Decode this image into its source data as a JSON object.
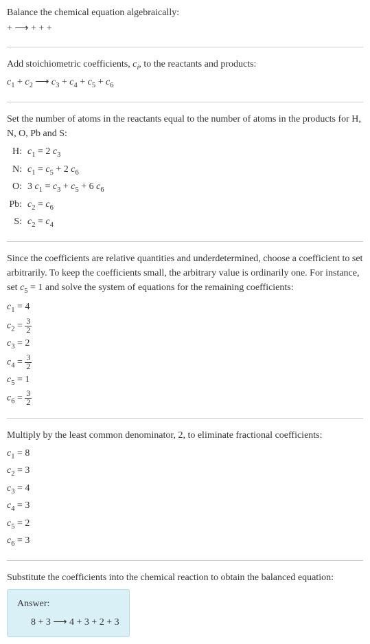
{
  "section1": {
    "title": "Balance the chemical equation algebraically:",
    "eq": " +  ⟶  +  +  + "
  },
  "section2": {
    "title_part1": "Add stoichiometric coefficients, ",
    "title_ci": "c",
    "title_i": "i",
    "title_part2": ", to the reactants and products:",
    "eq_c1": "c",
    "eq_1": "1",
    "eq_plus1": " + ",
    "eq_c2": "c",
    "eq_2": "2",
    "eq_arrow": " ⟶ ",
    "eq_c3": "c",
    "eq_3": "3",
    "eq_plus2": " + ",
    "eq_c4": "c",
    "eq_4": "4",
    "eq_plus3": " + ",
    "eq_c5": "c",
    "eq_5": "5",
    "eq_plus4": " + ",
    "eq_c6": "c",
    "eq_6": "6"
  },
  "section3": {
    "title": "Set the number of atoms in the reactants equal to the number of atoms in the products for H, N, O, Pb and S:",
    "atoms": [
      {
        "label": "H:",
        "lhs_c": "c",
        "lhs_s": "1",
        "eq": " = 2 ",
        "rhs_c": "c",
        "rhs_s": "3",
        "extra": ""
      },
      {
        "label": "N:",
        "lhs_c": "c",
        "lhs_s": "1",
        "eq": " = ",
        "rhs_c": "c",
        "rhs_s": "5",
        "extra": " + 2 ",
        "ex_c": "c",
        "ex_s": "6"
      },
      {
        "label": "O:",
        "pre": "3 ",
        "lhs_c": "c",
        "lhs_s": "1",
        "eq": " = ",
        "rhs_c": "c",
        "rhs_s": "3",
        "extra": " + ",
        "ex_c": "c",
        "ex_s": "5",
        "extra2": " + 6 ",
        "ex2_c": "c",
        "ex2_s": "6"
      },
      {
        "label": "Pb:",
        "lhs_c": "c",
        "lhs_s": "2",
        "eq": " = ",
        "rhs_c": "c",
        "rhs_s": "6",
        "extra": ""
      },
      {
        "label": "S:",
        "lhs_c": "c",
        "lhs_s": "2",
        "eq": " = ",
        "rhs_c": "c",
        "rhs_s": "4",
        "extra": ""
      }
    ]
  },
  "section4": {
    "title_part1": "Since the coefficients are relative quantities and underdetermined, choose a coefficient to set arbitrarily. To keep the coefficients small, the arbitrary value is ordinarily one. For instance, set ",
    "title_c": "c",
    "title_5": "5",
    "title_part2": " = 1 and solve the system of equations for the remaining coefficients:",
    "coeffs": [
      {
        "c": "c",
        "s": "1",
        "eq": " = ",
        "val": "4",
        "frac": false
      },
      {
        "c": "c",
        "s": "2",
        "eq": " = ",
        "num": "3",
        "den": "2",
        "frac": true
      },
      {
        "c": "c",
        "s": "3",
        "eq": " = ",
        "val": "2",
        "frac": false
      },
      {
        "c": "c",
        "s": "4",
        "eq": " = ",
        "num": "3",
        "den": "2",
        "frac": true
      },
      {
        "c": "c",
        "s": "5",
        "eq": " = ",
        "val": "1",
        "frac": false
      },
      {
        "c": "c",
        "s": "6",
        "eq": " = ",
        "num": "3",
        "den": "2",
        "frac": true
      }
    ]
  },
  "section5": {
    "title": "Multiply by the least common denominator, 2, to eliminate fractional coefficients:",
    "coeffs": [
      {
        "c": "c",
        "s": "1",
        "eq": " = ",
        "val": "8"
      },
      {
        "c": "c",
        "s": "2",
        "eq": " = ",
        "val": "3"
      },
      {
        "c": "c",
        "s": "3",
        "eq": " = ",
        "val": "4"
      },
      {
        "c": "c",
        "s": "4",
        "eq": " = ",
        "val": "3"
      },
      {
        "c": "c",
        "s": "5",
        "eq": " = ",
        "val": "2"
      },
      {
        "c": "c",
        "s": "6",
        "eq": " = ",
        "val": "3"
      }
    ]
  },
  "section6": {
    "title": "Substitute the coefficients into the chemical reaction to obtain the balanced equation:",
    "answer_label": "Answer:",
    "answer_eq": "8  + 3  ⟶ 4  + 3  + 2  + 3 "
  }
}
